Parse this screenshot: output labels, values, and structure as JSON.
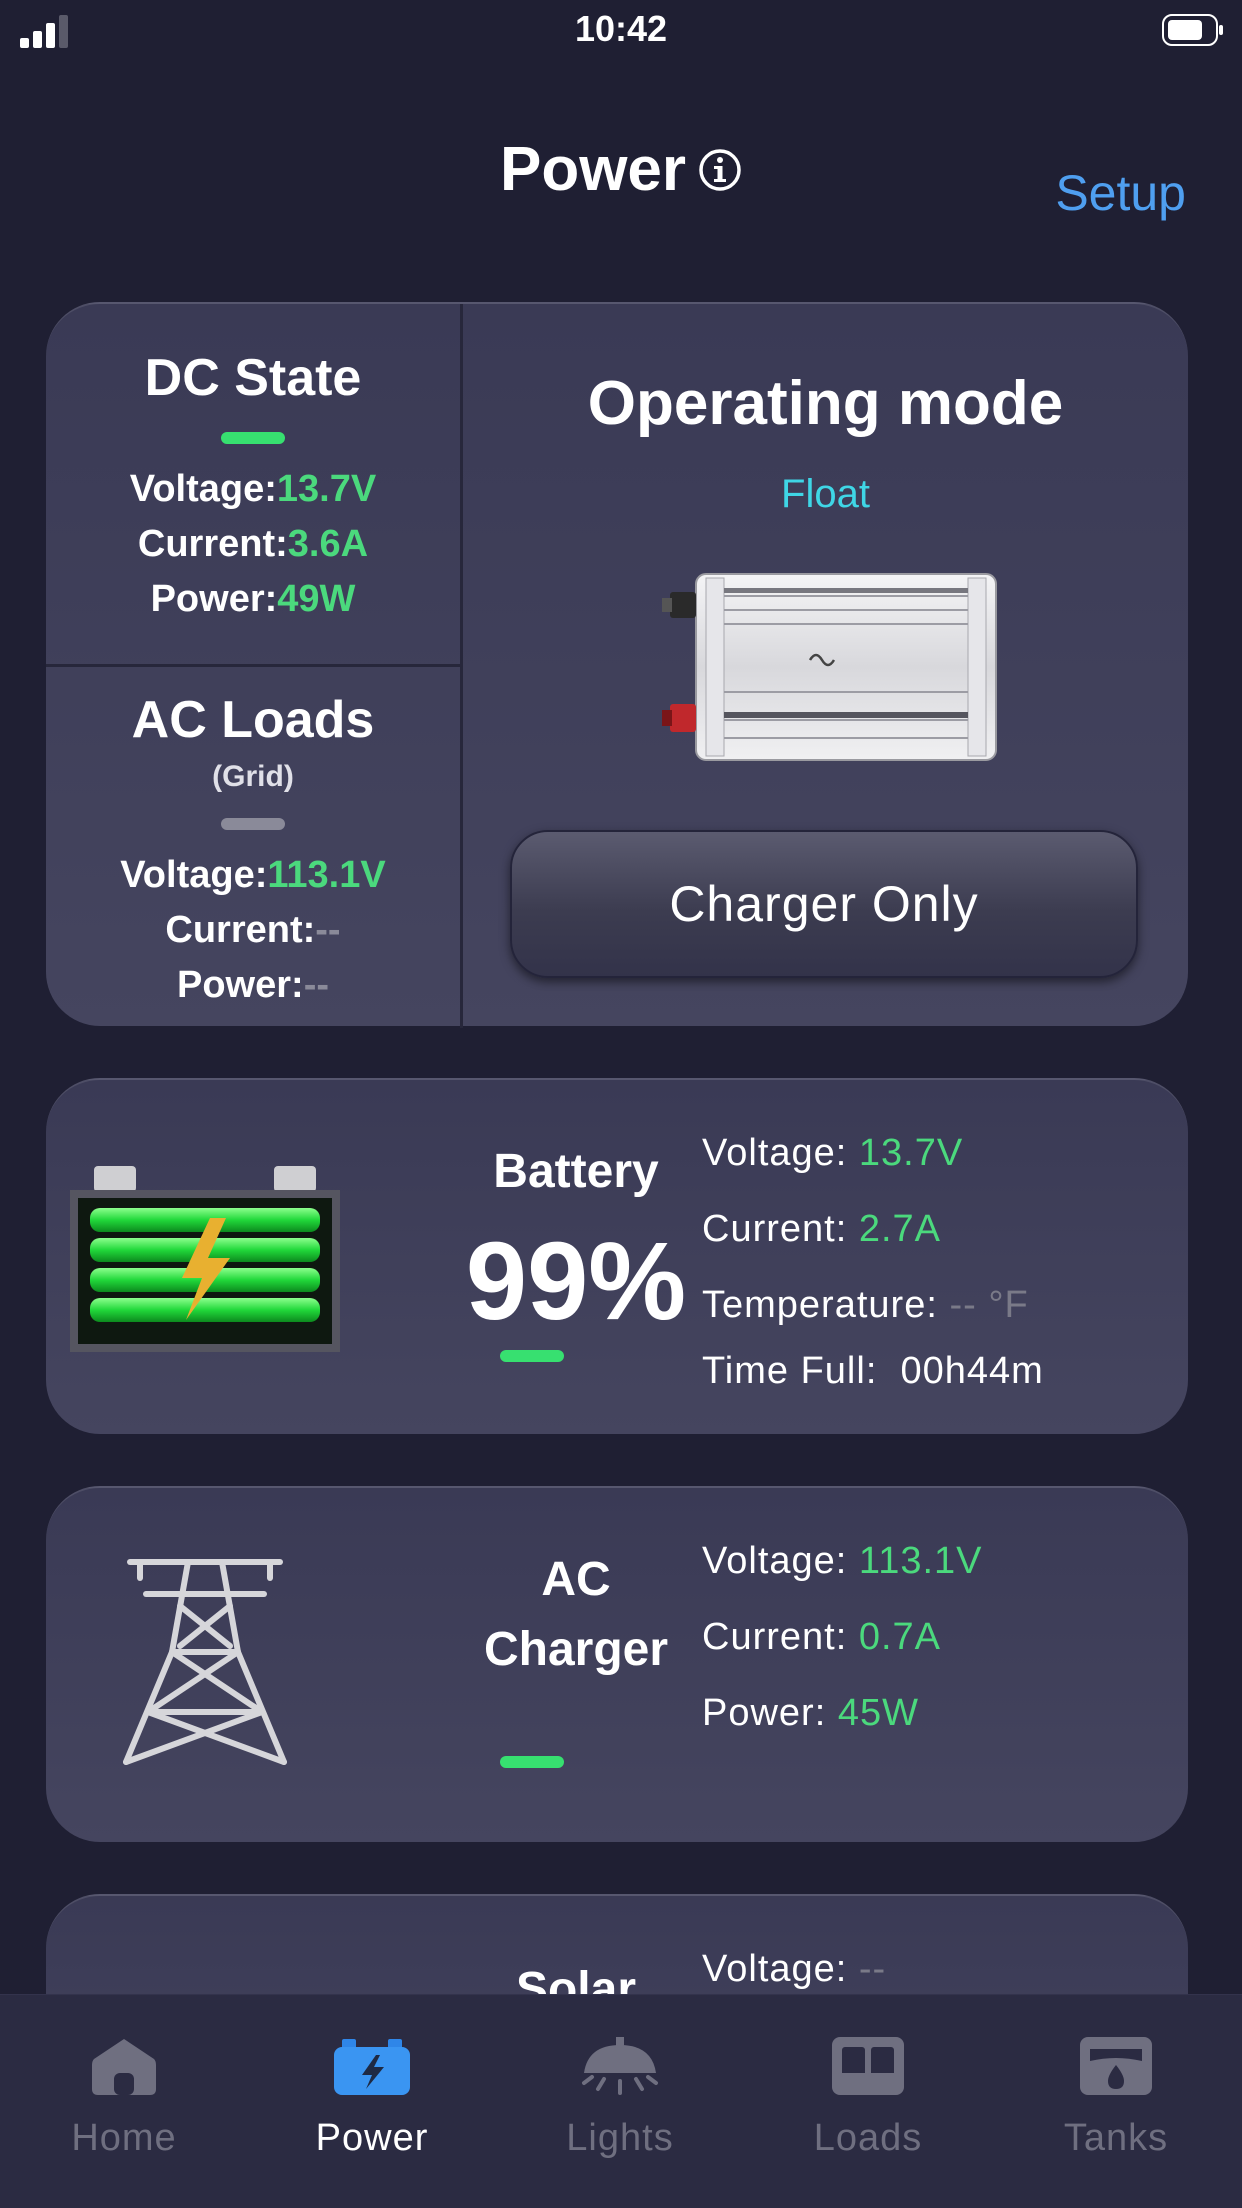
{
  "status_bar": {
    "time": "10:42"
  },
  "header": {
    "title": "Power",
    "setup_label": "Setup"
  },
  "dc_state": {
    "title": "DC State",
    "voltage_label": "Voltage:",
    "voltage_value": "13.7V",
    "current_label": "Current:",
    "current_value": "3.6A",
    "power_label": "Power:",
    "power_value": "49W"
  },
  "ac_loads": {
    "title": "AC Loads",
    "subtitle": "(Grid)",
    "voltage_label": "Voltage:",
    "voltage_value": "113.1V",
    "current_label": "Current:",
    "current_value": "--",
    "power_label": "Power:",
    "power_value": "--"
  },
  "operating_mode": {
    "title": "Operating mode",
    "mode": "Float",
    "button_label": "Charger Only"
  },
  "battery": {
    "title": "Battery",
    "percent": "99%",
    "voltage_label": "Voltage:",
    "voltage_value": "13.7V",
    "current_label": "Current:",
    "current_value": "2.7A",
    "temperature_label": "Temperature:",
    "temperature_value": "-- °F",
    "time_full_label": "Time Full:",
    "time_full_value": "00h44m"
  },
  "ac_charger": {
    "title_line1": "AC",
    "title_line2": "Charger",
    "voltage_label": "Voltage:",
    "voltage_value": "113.1V",
    "current_label": "Current:",
    "current_value": "0.7A",
    "power_label": "Power:",
    "power_value": "45W"
  },
  "solar": {
    "title": "Solar",
    "voltage_label": "Voltage:",
    "voltage_value": "--"
  },
  "tabs": [
    {
      "label": "Home",
      "icon": "home-icon",
      "active": false
    },
    {
      "label": "Power",
      "icon": "battery-icon",
      "active": true
    },
    {
      "label": "Lights",
      "icon": "lamp-icon",
      "active": false
    },
    {
      "label": "Loads",
      "icon": "panel-icon",
      "active": false
    },
    {
      "label": "Tanks",
      "icon": "tank-icon",
      "active": false
    }
  ],
  "colors": {
    "background": "#1f1f33",
    "card": "#3f3f59",
    "accent_green": "#4bd97d",
    "accent_blue": "#4f9ff0",
    "accent_cyan": "#3fd6e6"
  }
}
